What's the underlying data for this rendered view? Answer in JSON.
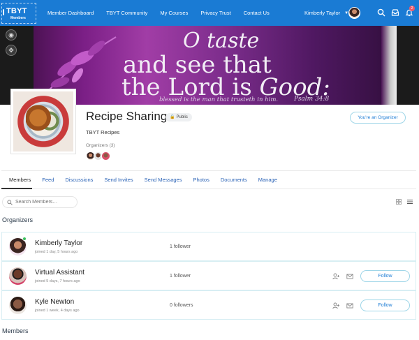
{
  "brand": {
    "logo_main": "TBYT",
    "logo_sub": "Members"
  },
  "nav": {
    "links": [
      "Member Dashboard",
      "TBYT Community",
      "My Courses",
      "Privacy Trust",
      "Contact Us"
    ],
    "user_name": "Kimberly Taylor",
    "notification_count": "2"
  },
  "banner": {
    "line1": "O taste",
    "line2": "and see that",
    "line3_a": "the Lord is",
    "line3_b": "Good:",
    "line4": "blessed is the man that trusteth in him.",
    "reference": "Psalm 34:8"
  },
  "group": {
    "title": "Recipe Sharing",
    "privacy": "Public",
    "subtitle": "TBYT Recipes",
    "organizers_label": "Organizers (3)",
    "role_button": "You're an Organizer"
  },
  "tabs": [
    "Members",
    "Feed",
    "Discussions",
    "Send Invites",
    "Send Messages",
    "Photos",
    "Documents",
    "Manage"
  ],
  "search": {
    "placeholder": "Search Members…"
  },
  "sections": {
    "organizers": "Organizers",
    "members": "Members"
  },
  "members": [
    {
      "name": "Kimberly Taylor",
      "joined": "joined 1 day, 5 hours ago",
      "followers": "1 follower",
      "follow_label": ""
    },
    {
      "name": "Virtual Assistant",
      "joined": "joined 5 days, 7 hours ago",
      "followers": "1 follower",
      "follow_label": "Follow"
    },
    {
      "name": "Kyle Newton",
      "joined": "joined 1 week, 4 days ago",
      "followers": "0 followers",
      "follow_label": "Follow"
    }
  ],
  "colors": {
    "nav_bg": "#1a7bd4",
    "accent": "#1a7bd4",
    "online": "#3bbf5e",
    "badge": "#ef5b6b"
  }
}
